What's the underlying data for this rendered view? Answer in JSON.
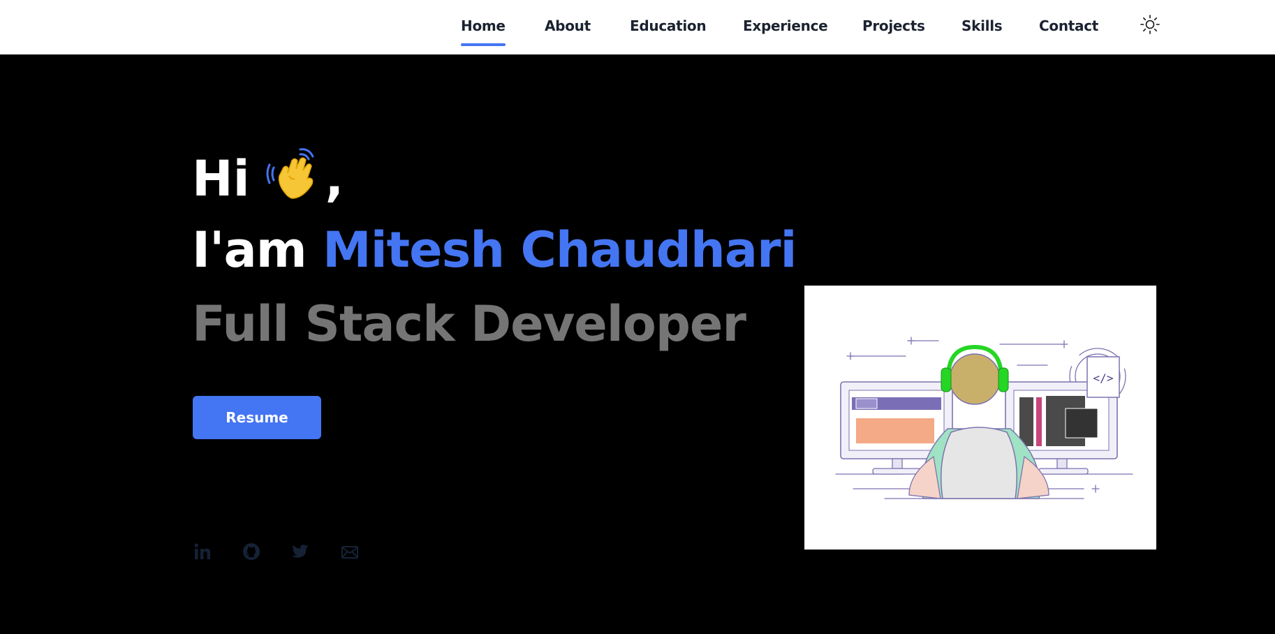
{
  "nav": {
    "items": [
      {
        "label": "Home",
        "active": true
      },
      {
        "label": "About"
      },
      {
        "label": "Education"
      },
      {
        "label": "Experience"
      },
      {
        "label": "Projects"
      },
      {
        "label": "Skills"
      },
      {
        "label": "Contact"
      }
    ],
    "theme_icon": "sun-icon"
  },
  "hero": {
    "greeting": "Hi",
    "greeting_emoji": "waving-hand",
    "greeting_punct": ",",
    "intro": "I'am",
    "name": "Mitesh Chaudhari",
    "role": "Full Stack Developer",
    "resume_label": "Resume"
  },
  "social": [
    "linkedin-icon",
    "github-icon",
    "twitter-icon",
    "mail-icon"
  ],
  "colors": {
    "accent": "#4475f2",
    "background": "#000000",
    "role_text": "#757575",
    "nav_bg": "#ffffff",
    "social_icons": "#152235"
  },
  "illustration": "developer-at-desk"
}
